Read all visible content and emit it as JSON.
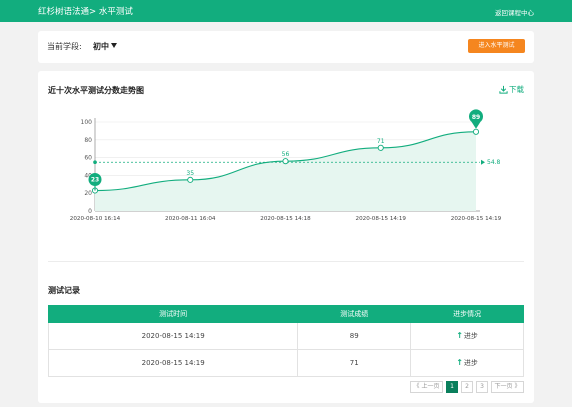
{
  "header": {
    "brand": "红杉树语法通> 水平测试",
    "back_label": "返回课程中心"
  },
  "stage": {
    "label": "当前学段:",
    "selected": "初中",
    "enter_button": "进入水平测试"
  },
  "chart_section": {
    "title": "近十次水平测试分数走势图",
    "download_label": "下载"
  },
  "chart_data": {
    "type": "line",
    "x": [
      "2020-08-10 16:14",
      "2020-08-11 16:04",
      "2020-08-15 14:18",
      "2020-08-15 14:19",
      "2020-08-15 14:19"
    ],
    "values": [
      23,
      35,
      56,
      71,
      89
    ],
    "point_labels": [
      "",
      "35",
      "56",
      "71",
      ""
    ],
    "min_marker": {
      "index": 0,
      "label": "23"
    },
    "max_marker": {
      "index": 4,
      "label": "89"
    },
    "average": 54.8,
    "average_label": "54.8",
    "yticks": [
      "0",
      "20",
      "40",
      "60",
      "80",
      "100"
    ],
    "ylim": [
      0,
      100
    ],
    "grid": true,
    "line_color": "#12ad7e",
    "fill_color": "#e6f6f0"
  },
  "records": {
    "title": "测试记录",
    "headers": [
      "测试时间",
      "测试成绩",
      "进步情况"
    ],
    "rows": [
      {
        "time": "2020-08-15 14:19",
        "score": "89",
        "progress": "进步"
      },
      {
        "time": "2020-08-15 14:19",
        "score": "71",
        "progress": "进步"
      }
    ]
  },
  "pagination": {
    "prev": "《 上一页",
    "pages": [
      "1",
      "2",
      "3"
    ],
    "current": "1",
    "next": "下一页 》"
  },
  "colors": {
    "primary": "#12ad7e",
    "accent_orange": "#f5861f",
    "pager_active": "#0a7f5c"
  }
}
